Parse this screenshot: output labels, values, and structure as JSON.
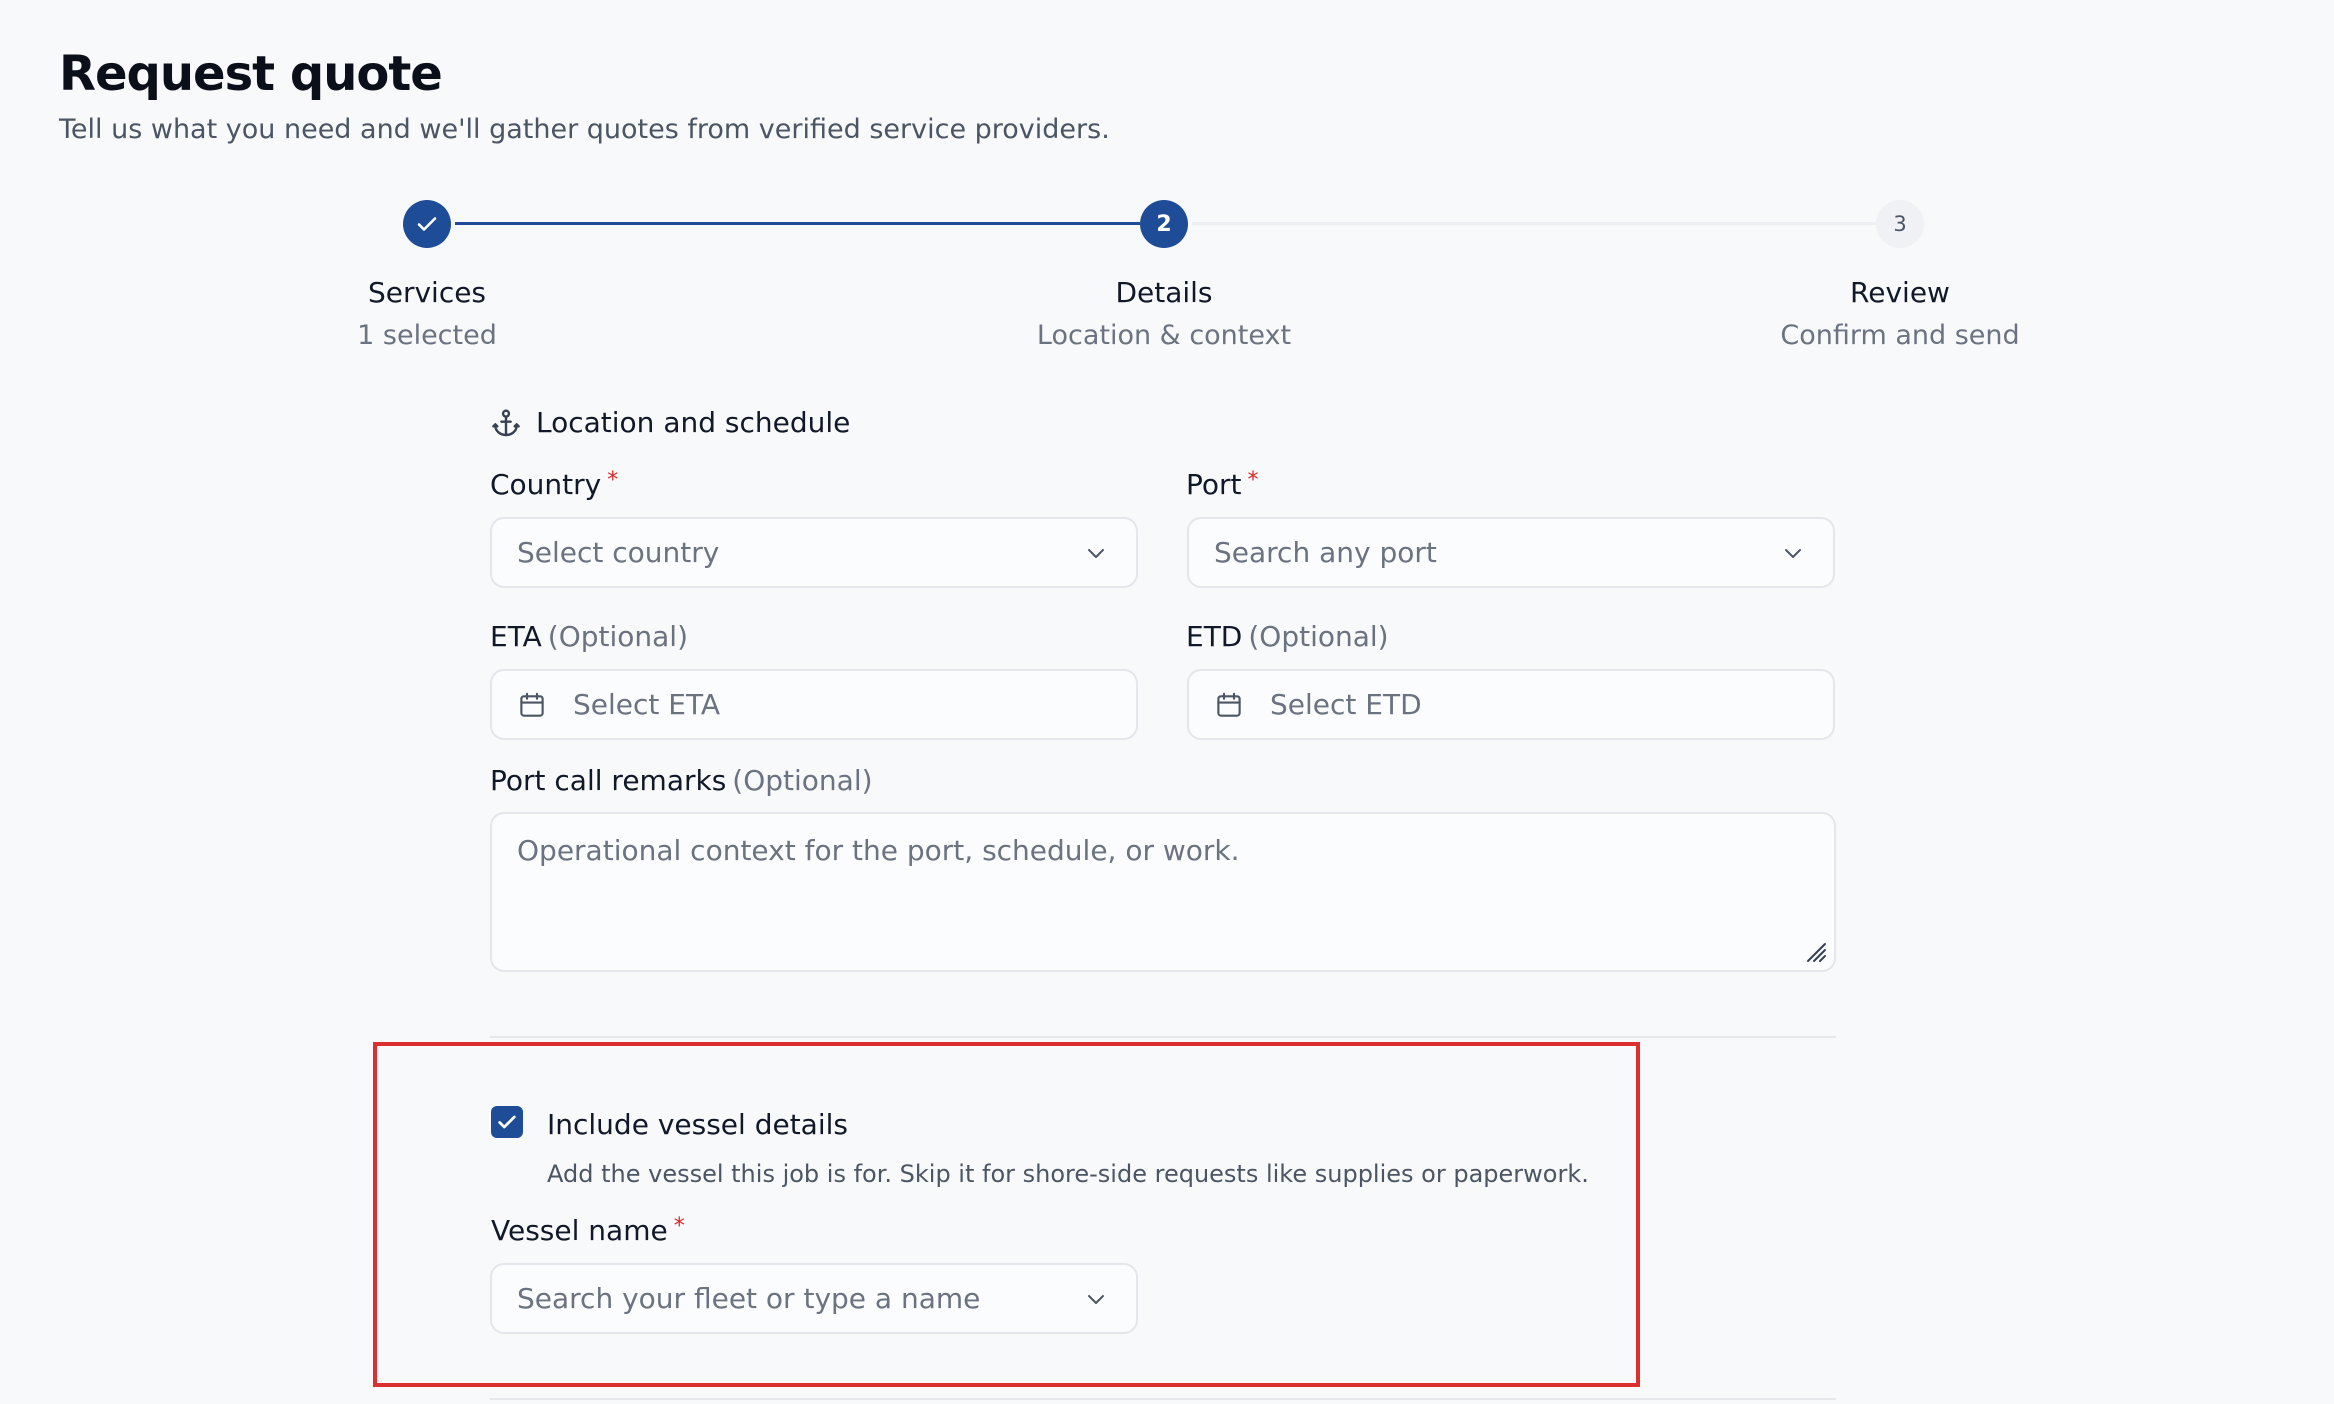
{
  "header": {
    "title": "Request quote",
    "subtitle": "Tell us what you need and we'll gather quotes from verified service providers."
  },
  "stepper": {
    "steps": [
      {
        "label": "Services",
        "sub": "1 selected",
        "state": "completed"
      },
      {
        "label": "Details",
        "sub": "Location & context",
        "number": "2",
        "state": "active"
      },
      {
        "label": "Review",
        "sub": "Confirm and send",
        "number": "3",
        "state": "upcoming"
      }
    ]
  },
  "location": {
    "section_title": "Location and schedule",
    "country": {
      "label": "Country",
      "required": "*",
      "placeholder": "Select country"
    },
    "port": {
      "label": "Port",
      "required": "*",
      "placeholder": "Search any port"
    },
    "eta": {
      "label": "ETA",
      "optional": "(Optional)",
      "placeholder": "Select ETA"
    },
    "etd": {
      "label": "ETD",
      "optional": "(Optional)",
      "placeholder": "Select ETD"
    },
    "remarks": {
      "label": "Port call remarks",
      "optional": "(Optional)",
      "placeholder": "Operational context for the port, schedule, or work."
    }
  },
  "vessel": {
    "include_label": "Include vessel details",
    "include_checked": true,
    "help": "Add the vessel this job is for. Skip it for shore-side requests like supplies or paperwork.",
    "name": {
      "label": "Vessel name",
      "required": "*",
      "placeholder": "Search your fleet or type a name"
    }
  },
  "colors": {
    "accent": "#1e4c96",
    "required": "#dc2626",
    "highlight": "#dc2f2f"
  },
  "icons": [
    "check-icon",
    "anchor-icon",
    "chevron-down-icon",
    "calendar-icon",
    "resize-handle-icon"
  ]
}
